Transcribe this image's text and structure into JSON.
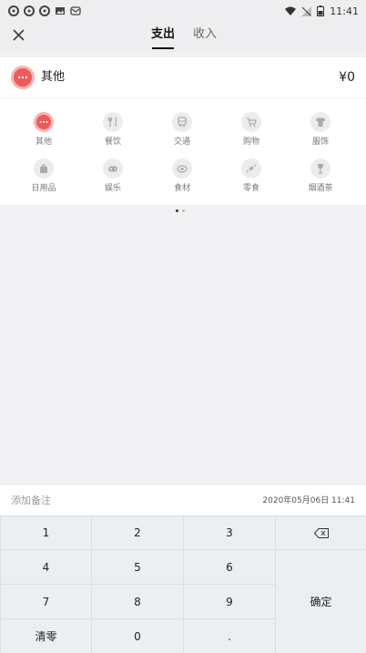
{
  "status_bar": {
    "time": "11:41"
  },
  "header": {
    "tab_expense": "支出",
    "tab_income": "收入"
  },
  "selected": {
    "name": "其他",
    "amount": "¥0"
  },
  "categories": [
    {
      "label": "其他",
      "icon": "more-icon",
      "active": true
    },
    {
      "label": "餐饮",
      "icon": "utensils-icon"
    },
    {
      "label": "交通",
      "icon": "bus-icon"
    },
    {
      "label": "购物",
      "icon": "cart-icon"
    },
    {
      "label": "服饰",
      "icon": "shirt-icon"
    },
    {
      "label": "日用品",
      "icon": "tissue-icon"
    },
    {
      "label": "娱乐",
      "icon": "gamepad-icon"
    },
    {
      "label": "食材",
      "icon": "meat-icon"
    },
    {
      "label": "零食",
      "icon": "candy-icon"
    },
    {
      "label": "烟酒茶",
      "icon": "glass-icon"
    }
  ],
  "note": {
    "placeholder": "添加备注",
    "date": "2020年05月06日 11:41"
  },
  "keypad": {
    "k1": "1",
    "k2": "2",
    "k3": "3",
    "k4": "4",
    "k5": "5",
    "k6": "6",
    "k7": "7",
    "k8": "8",
    "k9": "9",
    "clear": "清零",
    "k0": "0",
    "dot": ".",
    "confirm": "确定"
  }
}
